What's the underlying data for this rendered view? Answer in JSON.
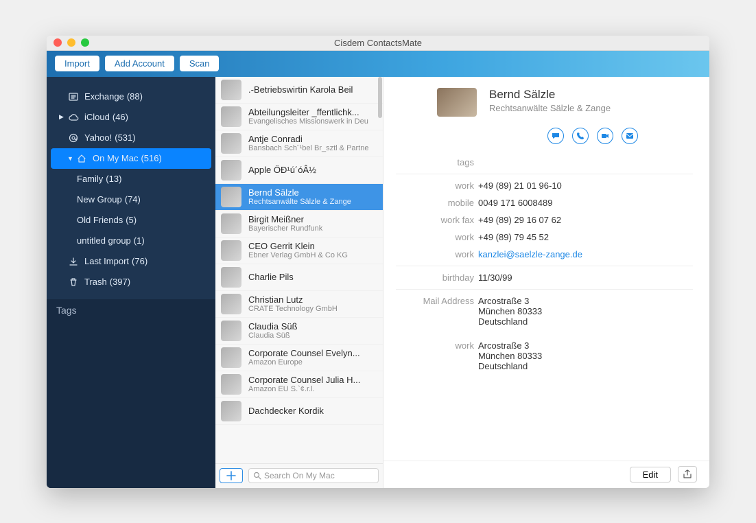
{
  "window": {
    "title": "Cisdem ContactsMate"
  },
  "toolbar": {
    "import": "Import",
    "add_account": "Add Account",
    "scan": "Scan"
  },
  "sidebar": {
    "items": [
      {
        "icon": "exchange",
        "label": "Exchange",
        "count": "(88)",
        "depth": 1,
        "arrow": ""
      },
      {
        "icon": "cloud",
        "label": "iCloud",
        "count": "(46)",
        "depth": 0,
        "arrow": "▶"
      },
      {
        "icon": "at",
        "label": "Yahoo!",
        "count": "(531)",
        "depth": 1,
        "arrow": ""
      },
      {
        "icon": "home",
        "label": "On My Mac",
        "count": "(516)",
        "depth": 0,
        "arrow": "▼",
        "selected": true
      },
      {
        "icon": "",
        "label": "Family",
        "count": "(13)",
        "depth": 2,
        "arrow": ""
      },
      {
        "icon": "",
        "label": "New Group",
        "count": "(74)",
        "depth": 2,
        "arrow": ""
      },
      {
        "icon": "",
        "label": "Old Friends",
        "count": "(5)",
        "depth": 2,
        "arrow": ""
      },
      {
        "icon": "",
        "label": "untitled group",
        "count": "(1)",
        "depth": 2,
        "arrow": ""
      },
      {
        "icon": "import",
        "label": "Last Import",
        "count": "(76)",
        "depth": 1,
        "arrow": ""
      },
      {
        "icon": "trash",
        "label": "Trash",
        "count": "(397)",
        "depth": 1,
        "arrow": ""
      }
    ],
    "tags_header": "Tags"
  },
  "contacts": [
    {
      "name": ".-Betriebswirtin Karola Beil",
      "sub": ""
    },
    {
      "name": "Abteilungsleiter _ffentlichk...",
      "sub": "Evangelisches Missionswerk in Deu"
    },
    {
      "name": "Antje Conradi",
      "sub": "Bansbach Sch¨¹bel Br_sztl & Partne"
    },
    {
      "name": "Apple ÖÐ¹ú´óÂ½",
      "sub": ""
    },
    {
      "name": "Bernd Sälzle",
      "sub": "Rechtsanwälte Sälzle & Zange",
      "selected": true
    },
    {
      "name": "Birgit Meißner",
      "sub": "Bayerischer Rundfunk"
    },
    {
      "name": "CEO Gerrit Klein",
      "sub": "Ebner Verlag GmbH & Co KG"
    },
    {
      "name": "Charlie Pils",
      "sub": ""
    },
    {
      "name": "Christian Lutz",
      "sub": "CRATE Technology GmbH"
    },
    {
      "name": "Claudia Süß",
      "sub": "Claudia Süß"
    },
    {
      "name": "Corporate Counsel Evelyn...",
      "sub": "Amazon Europe"
    },
    {
      "name": "Corporate Counsel Julia H...",
      "sub": "Amazon EU S.`¢.r.l."
    },
    {
      "name": "Dachdecker Kordik",
      "sub": ""
    }
  ],
  "search": {
    "placeholder": "Search On My Mac"
  },
  "detail": {
    "name": "Bernd Sälzle",
    "org": "Rechtsanwälte Sälzle & Zange",
    "fields": [
      {
        "label": "tags",
        "value": ""
      },
      {
        "divider": true
      },
      {
        "label": "work",
        "value": "+49 (89) 21 01 96-10"
      },
      {
        "label": "mobile",
        "value": "0049 171 6008489"
      },
      {
        "label": "work fax",
        "value": "+49 (89) 29 16 07 62"
      },
      {
        "label": "work",
        "value": "+49 (89) 79 45 52"
      },
      {
        "label": "work",
        "value": "kanzlei@saelzle-zange.de",
        "link": true
      },
      {
        "divider": true
      },
      {
        "label": "birthday",
        "value": "11/30/99"
      },
      {
        "divider": true
      },
      {
        "label": "Mail Address",
        "value": "Arcostraße 3\nMünchen 80333\nDeutschland"
      },
      {
        "label": "",
        "value": ""
      },
      {
        "label": "work",
        "value": "Arcostraße 3\nMünchen 80333\nDeutschland"
      }
    ],
    "edit": "Edit"
  }
}
